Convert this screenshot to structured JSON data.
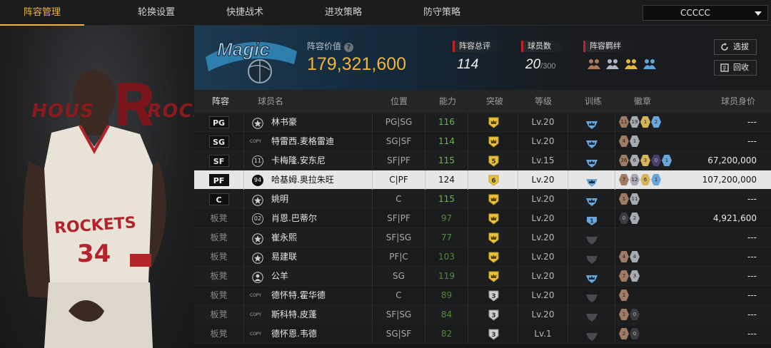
{
  "nav": {
    "tabs": [
      "阵容管理",
      "轮换设置",
      "快捷战术",
      "进攻策略",
      "防守策略"
    ],
    "active_index": 0,
    "dropdown_value": "CCCCC"
  },
  "player_art": {
    "wordmark_left": "HOUS",
    "wordmark_right": "ROCK",
    "jersey_team": "ROCKETS",
    "jersey_number": "34"
  },
  "team_logo_text": "Magic",
  "lineup_value": {
    "label": "阵容价值",
    "value": "179,321,600"
  },
  "stats": [
    {
      "label": "阵容总评",
      "value": "114"
    },
    {
      "label": "球员数",
      "value": "20",
      "suffix": "/300"
    },
    {
      "label": "阵容羁绊"
    }
  ],
  "buttons": {
    "pick": "选拔",
    "recycle": "回收"
  },
  "columns": [
    "阵容",
    "球员名",
    "位置",
    "能力",
    "突破",
    "等级",
    "训练",
    "徽章",
    "球员身价"
  ],
  "rows": [
    {
      "slot": "PG",
      "starter": true,
      "icon": "star",
      "name": "林书豪",
      "position": "PG|SG",
      "ability": "116",
      "breakout": "crown",
      "level": "Lv.20",
      "train": "blue",
      "badges": [
        [
          "bronze",
          "11"
        ],
        [
          "silver",
          "19"
        ],
        [
          "gold",
          "1"
        ],
        [
          "blue",
          "2"
        ]
      ],
      "worth": "---"
    },
    {
      "slot": "SG",
      "starter": true,
      "icon": "copy",
      "name": "特雷西.麦格雷迪",
      "position": "SG|SF",
      "ability": "114",
      "breakout": "crown",
      "level": "Lv.20",
      "train": "blue",
      "badges": [
        [
          "bronze",
          "4"
        ],
        [
          "silver",
          "1"
        ]
      ],
      "worth": "---"
    },
    {
      "slot": "SF",
      "starter": true,
      "icon": "11",
      "name": "卡梅隆.安东尼",
      "position": "SF|PF",
      "ability": "115",
      "breakout": "5",
      "level": "Lv.15",
      "train": "blue",
      "badges": [
        [
          "bronze",
          "26"
        ],
        [
          "silver",
          "6"
        ],
        [
          "gold",
          "3"
        ],
        [
          "purple",
          "0"
        ],
        [
          "blue",
          "1"
        ]
      ],
      "worth": "67,200,000"
    },
    {
      "slot": "PF",
      "starter": true,
      "selected": true,
      "icon": "94",
      "name": "哈基姆.奥拉朱旺",
      "position": "C|PF",
      "ability": "124",
      "breakout": "6",
      "level": "Lv.20",
      "train": "blue",
      "badges": [
        [
          "bronze",
          "7"
        ],
        [
          "silver",
          "12"
        ],
        [
          "gold",
          "6"
        ],
        [
          "blue",
          "1"
        ]
      ],
      "worth": "107,200,000"
    },
    {
      "slot": "C",
      "starter": true,
      "icon": "star",
      "name": "姚明",
      "position": "C",
      "ability": "115",
      "breakout": "crown",
      "level": "Lv.20",
      "train": "blue",
      "badges": [
        [
          "bronze",
          "1"
        ],
        [
          "silver",
          "11"
        ]
      ],
      "worth": "---"
    },
    {
      "slot": "板凳",
      "starter": false,
      "icon": "02",
      "name": "肖恩.巴蒂尔",
      "position": "SF|PF",
      "ability": "97",
      "breakout": "crown",
      "level": "Lv.20",
      "train": "blue1",
      "badges": [
        [
          "dark",
          "0"
        ],
        [
          "silver",
          "2"
        ]
      ],
      "worth": "4,921,600"
    },
    {
      "slot": "板凳",
      "starter": false,
      "icon": "star",
      "name": "崔永熙",
      "position": "SF|SG",
      "ability": "77",
      "breakout": "crown",
      "level": "Lv.20",
      "train": "gray",
      "badges": [],
      "worth": "---"
    },
    {
      "slot": "板凳",
      "starter": false,
      "icon": "star",
      "name": "易建联",
      "position": "PF|C",
      "ability": "103",
      "breakout": "crown",
      "level": "Lv.20",
      "train": "gray",
      "badges": [
        [
          "bronze",
          "4"
        ],
        [
          "silver",
          "4"
        ]
      ],
      "worth": "---"
    },
    {
      "slot": "板凳",
      "starter": false,
      "icon": "person",
      "name": "公羊",
      "position": "SG",
      "ability": "119",
      "breakout": "crown",
      "level": "Lv.20",
      "train": "blue",
      "badges": [
        [
          "bronze",
          "7"
        ],
        [
          "silver",
          "3"
        ]
      ],
      "worth": "---"
    },
    {
      "slot": "板凳",
      "starter": false,
      "icon": "copy",
      "name": "德怀特.霍华德",
      "position": "C",
      "ability": "89",
      "breakout": "3",
      "level": "Lv.20",
      "train": "gray",
      "badges": [
        [
          "bronze",
          "1"
        ]
      ],
      "worth": "---"
    },
    {
      "slot": "板凳",
      "starter": false,
      "icon": "copy",
      "name": "斯科特.皮蓬",
      "position": "SF|SG",
      "ability": "84",
      "breakout": "3",
      "level": "Lv.20",
      "train": "gray",
      "badges": [
        [
          "bronze",
          "1"
        ],
        [
          "dark",
          "0"
        ]
      ],
      "worth": "---"
    },
    {
      "slot": "板凳",
      "starter": false,
      "icon": "copy",
      "name": "德怀恩.韦德",
      "position": "SG|SF",
      "ability": "82",
      "breakout": "3",
      "level": "Lv.1",
      "train": "gray",
      "badges": [
        [
          "bronze",
          "2"
        ],
        [
          "dark",
          "0"
        ]
      ],
      "worth": "---"
    }
  ],
  "colors": {
    "accent": "#f0b43a",
    "ability": "#6bb84a",
    "red_marker": "#c0242a"
  }
}
